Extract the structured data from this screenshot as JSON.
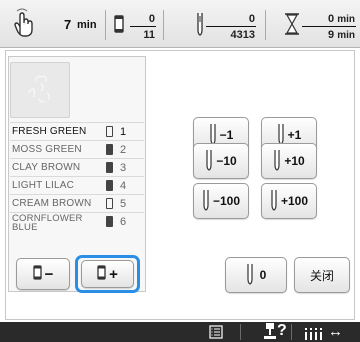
{
  "top_bar": {
    "time_value": "7",
    "time_unit": "min",
    "color_index": "0",
    "color_total": "11",
    "stitch_current": "0",
    "stitch_total": "4313",
    "time_elapsed": "0",
    "time_elapsed_unit": "min",
    "time_total": "9",
    "time_total_unit": "min",
    "icons": [
      "hand-pointer-icon",
      "spool-icon",
      "needle-icon",
      "hourglass-icon"
    ]
  },
  "thread_list": [
    {
      "name": "FRESH GREEN",
      "number": "1",
      "spool": "outline",
      "current": true
    },
    {
      "name": "MOSS GREEN",
      "number": "2",
      "spool": "filled",
      "current": false
    },
    {
      "name": "CLAY BROWN",
      "number": "3",
      "spool": "filled",
      "current": false
    },
    {
      "name": "LIGHT LILAC",
      "number": "4",
      "spool": "filled",
      "current": false
    },
    {
      "name": "CREAM BROWN",
      "number": "5",
      "spool": "outline",
      "current": false
    },
    {
      "name": "CORNFLOWER BLUE",
      "number": "6",
      "spool": "filled",
      "current": false
    }
  ],
  "list_buttons": {
    "minus_label": "−",
    "plus_label": "+"
  },
  "stitch_buttons": {
    "minus1": "−1",
    "plus1": "+1",
    "minus10": "−10",
    "plus10": "+10",
    "minus100": "−100",
    "plus100": "+100",
    "zero": "0",
    "close": "关闭"
  },
  "bottom_bar": {
    "help_label": "?",
    "move_label": "↔"
  },
  "colors": {
    "highlight": "#2b8ee6",
    "bottom_bar": "#2a2a2a"
  }
}
